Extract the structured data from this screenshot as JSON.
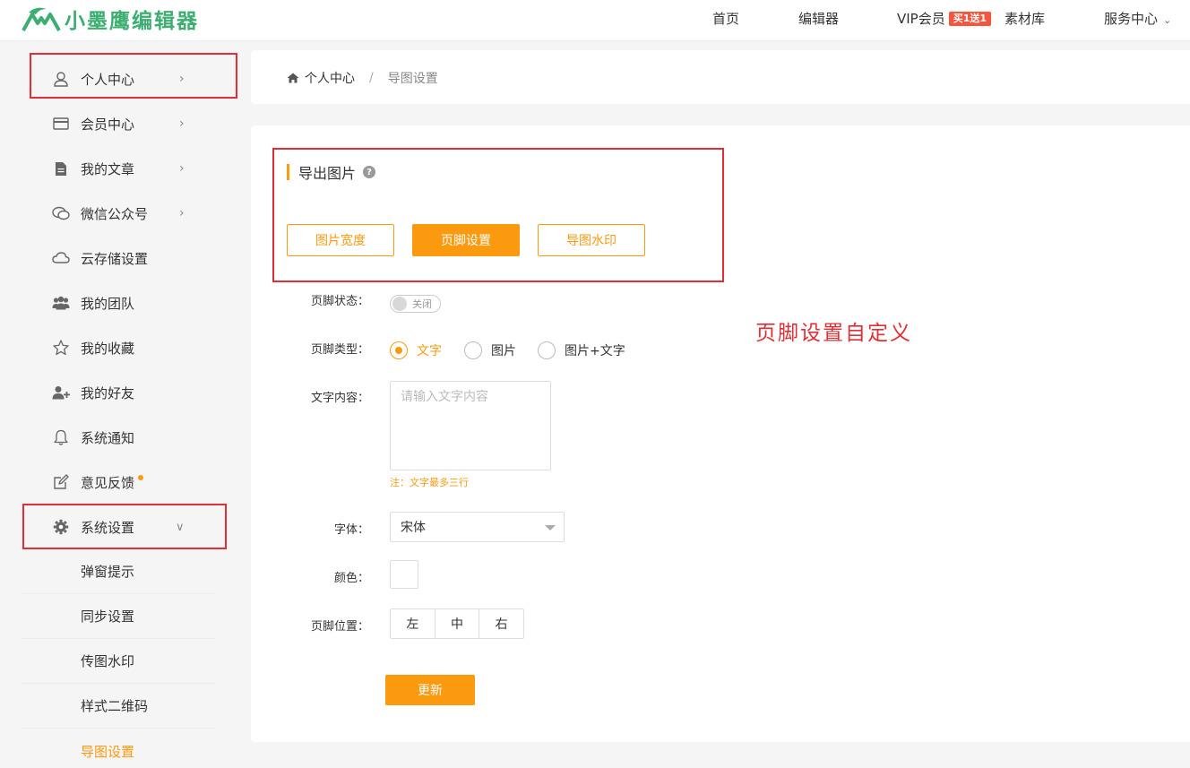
{
  "header": {
    "logo_text": "小墨鹰编辑器",
    "nav": {
      "home": "首页",
      "editor": "编辑器",
      "vip": "VIP会员",
      "vip_badge": "买1送1",
      "materials": "素材库",
      "service": "服务中心"
    }
  },
  "sidebar": {
    "items": [
      {
        "label": "个人中心",
        "icon": "user-icon",
        "has_arrow": true
      },
      {
        "label": "会员中心",
        "icon": "card-icon",
        "has_arrow": true
      },
      {
        "label": "我的文章",
        "icon": "document-icon",
        "has_arrow": true
      },
      {
        "label": "微信公众号",
        "icon": "chat-icon",
        "has_arrow": true
      },
      {
        "label": "云存储设置",
        "icon": "cloud-icon",
        "has_arrow": false
      },
      {
        "label": "我的团队",
        "icon": "team-icon",
        "has_arrow": false
      },
      {
        "label": "我的收藏",
        "icon": "star-icon",
        "has_arrow": false
      },
      {
        "label": "我的好友",
        "icon": "add-friend-icon",
        "has_arrow": false
      },
      {
        "label": "系统通知",
        "icon": "bell-icon",
        "has_arrow": false
      },
      {
        "label": "意见反馈",
        "icon": "edit-icon",
        "has_arrow": false
      },
      {
        "label": "系统设置",
        "icon": "gear-icon",
        "has_arrow": true
      }
    ],
    "sub_items": [
      {
        "label": "弹窗提示"
      },
      {
        "label": "同步设置"
      },
      {
        "label": "传图水印"
      },
      {
        "label": "样式二维码"
      },
      {
        "label": "导图设置",
        "active": true
      }
    ]
  },
  "breadcrumb": {
    "home": "个人中心",
    "separator": "/",
    "current": "导图设置"
  },
  "main": {
    "section_title": "导出图片",
    "tabs": [
      {
        "label": "图片宽度",
        "active": false
      },
      {
        "label": "页脚设置",
        "active": true
      },
      {
        "label": "导图水印",
        "active": false
      }
    ],
    "form": {
      "status_label": "页脚状态：",
      "status_toggle": "关闭",
      "type_label": "页脚类型：",
      "type_options": [
        "文字",
        "图片",
        "图片+文字"
      ],
      "type_selected": "文字",
      "content_label": "文字内容：",
      "content_placeholder": "请输入文字内容",
      "content_note": "注：文字最多三行",
      "font_label": "字体：",
      "font_value": "宋体",
      "color_label": "颜色：",
      "position_label": "页脚位置：",
      "position_options": [
        "左",
        "中",
        "右"
      ],
      "update_button": "更新"
    }
  },
  "annotation": "页脚设置自定义",
  "colors": {
    "accent": "#fb9a0e",
    "brand": "#3dae72",
    "highlight_box": "#e02f36",
    "vip_badge": "#f5553d"
  }
}
